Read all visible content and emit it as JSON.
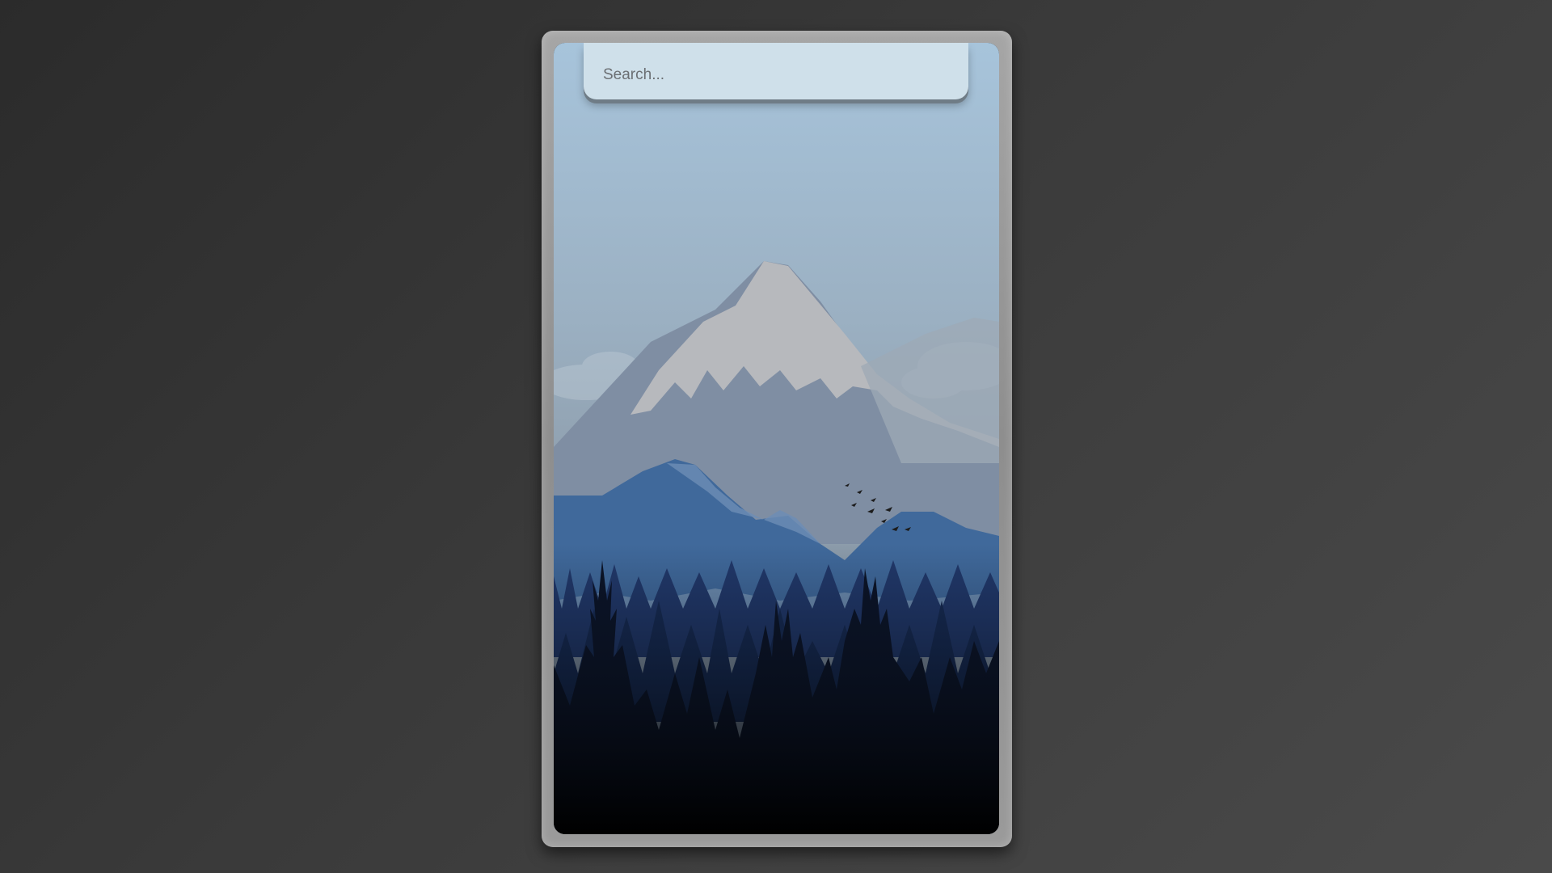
{
  "search": {
    "placeholder": "Search...",
    "value": ""
  },
  "wallpaper": {
    "subject": "mountain-forest-landscape",
    "colors": {
      "sky_top": "#a9c6dc",
      "sky_bottom": "#8aa0b2",
      "snow": "#b9bcc0",
      "mid_mountain": "#3f6a9e",
      "forest_dark": "#0d1a33"
    }
  },
  "icons": {
    "birds": "birds-icon"
  }
}
